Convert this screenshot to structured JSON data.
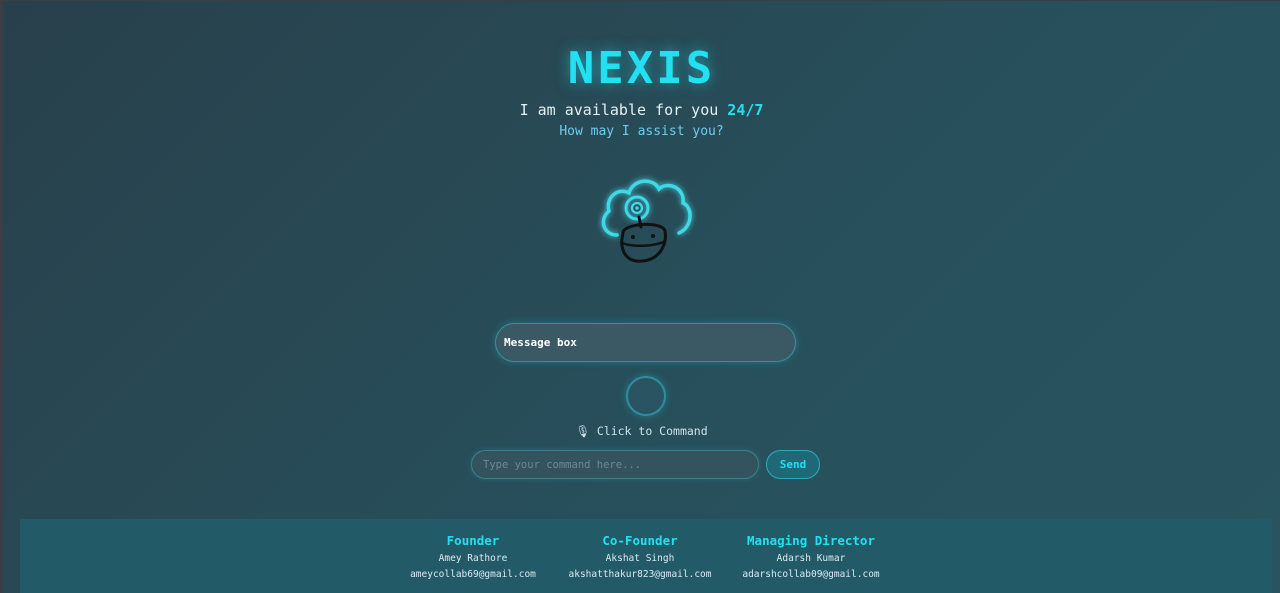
{
  "header": {
    "brand": "NEXIS",
    "tagline_prefix": "I am available for you",
    "tagline_accent": "24/7",
    "subline": "How may I assist you?"
  },
  "mascot": {
    "icon": "cloud-robot-icon"
  },
  "message_box": {
    "text": "Message box"
  },
  "voice": {
    "mic_icon": "microphone-icon",
    "label": "🎙 Click to Command"
  },
  "command": {
    "placeholder": "Type your command here...",
    "send_label": "Send"
  },
  "footer": {
    "credits": [
      {
        "role": "Founder",
        "name": "Amey Rathore",
        "email": "ameycollab69@gmail.com"
      },
      {
        "role": "Co-Founder",
        "name": "Akshat Singh",
        "email": "akshatthakur823@gmail.com"
      },
      {
        "role": "Managing Director",
        "name": "Adarsh Kumar",
        "email": "adarshcollab09@gmail.com"
      }
    ]
  },
  "colors": {
    "accent": "#22e0f2",
    "background": "#28474f",
    "footer": "#235a68"
  }
}
